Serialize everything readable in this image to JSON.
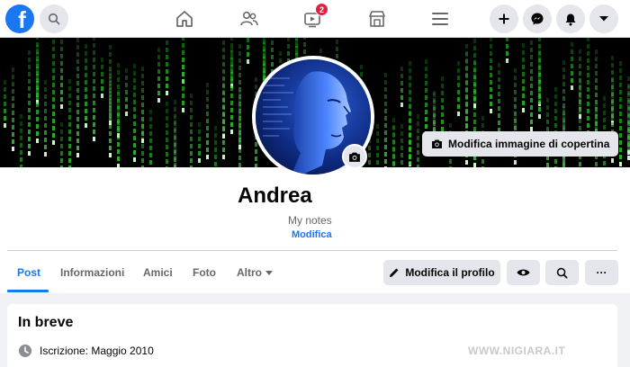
{
  "topbar": {
    "logo_letter": "f",
    "watch_badge": "2",
    "icons": [
      "facebook-logo",
      "search-icon",
      "home-icon",
      "friends-icon",
      "watch-icon",
      "marketplace-icon",
      "menu-icon",
      "plus-icon",
      "messenger-icon",
      "bell-icon",
      "caret-down-icon"
    ]
  },
  "cover": {
    "edit_label": "Modifica immagine di copertina"
  },
  "profile": {
    "name": "Andrea",
    "notes": "My notes",
    "edit_notes": "Modifica"
  },
  "tabs": [
    {
      "label": "Post",
      "active": true
    },
    {
      "label": "Informazioni",
      "active": false
    },
    {
      "label": "Amici",
      "active": false
    },
    {
      "label": "Foto",
      "active": false
    },
    {
      "label": "Altro",
      "active": false
    }
  ],
  "actions": {
    "edit_profile": "Modifica il profilo",
    "more": "···"
  },
  "intro": {
    "title": "In breve",
    "joined": "Iscrizione: Maggio 2010"
  },
  "watermark": "WWW.NIGIARA.IT",
  "colors": {
    "brand": "#1877f2",
    "badge": "#e41e3f",
    "cover_matrix": "#2ec12e"
  }
}
